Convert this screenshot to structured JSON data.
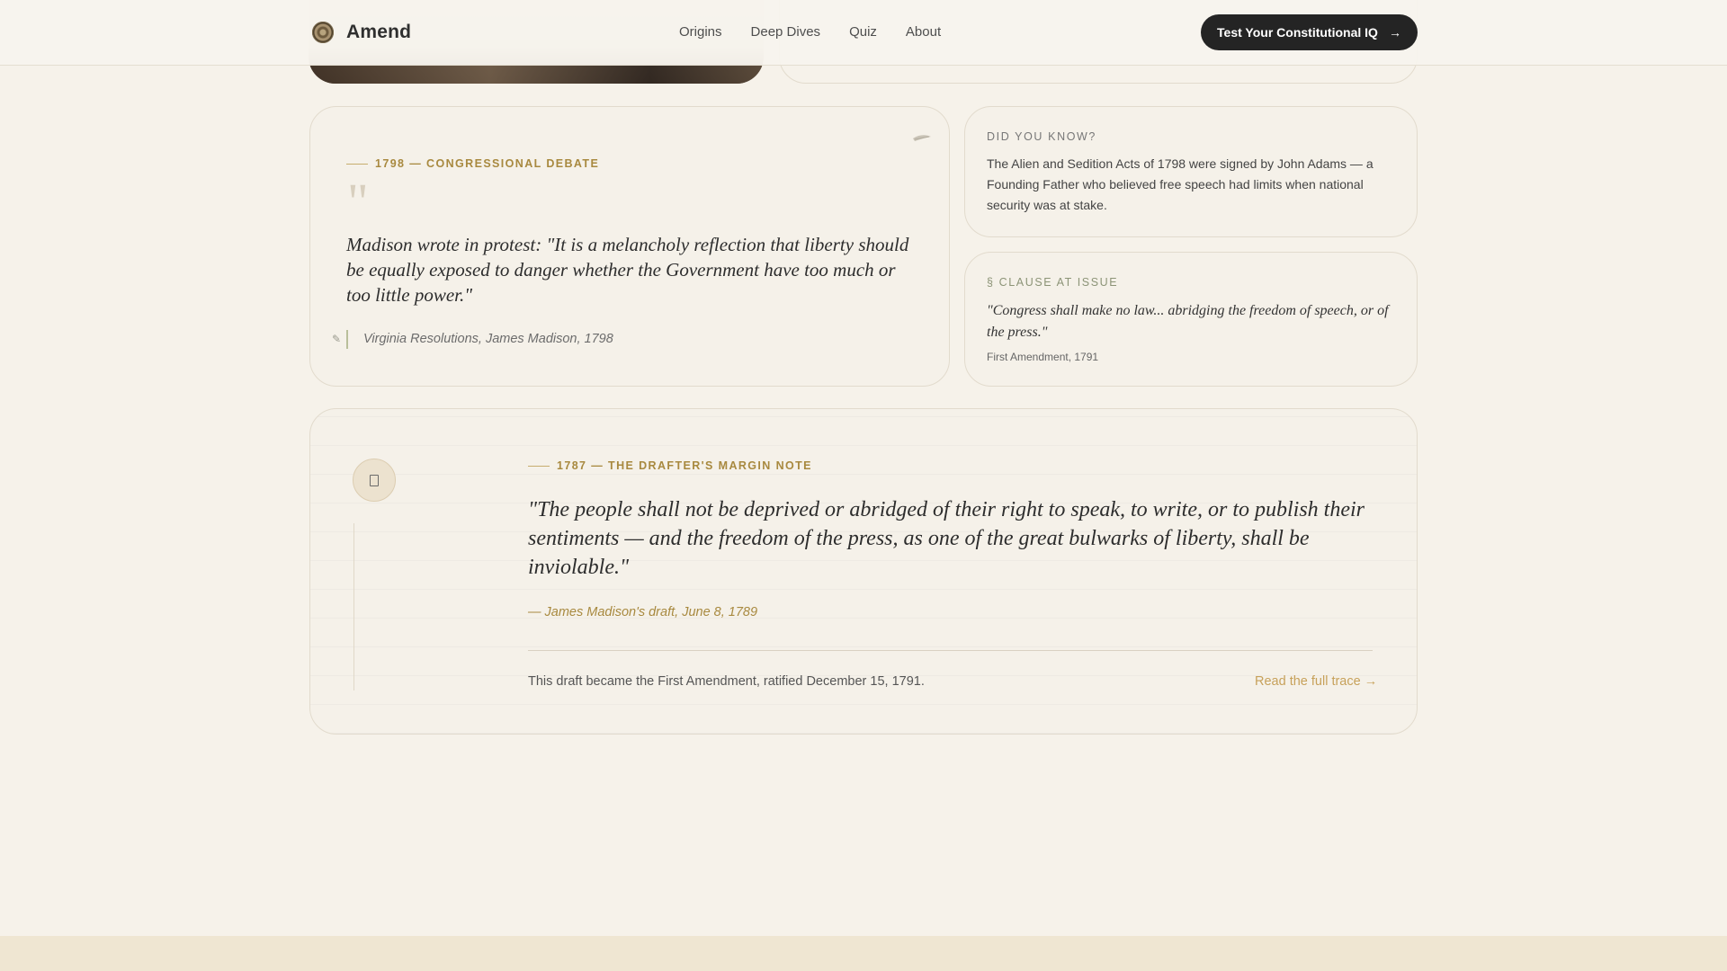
{
  "header": {
    "brand": "Amend",
    "nav": [
      "Origins",
      "Deep Dives",
      "Quiz",
      "About"
    ],
    "cta_label": "Test Your Constitutional IQ"
  },
  "debate": {
    "overline": "1798 — CONGRESSIONAL DEBATE",
    "quote_mark": "\"",
    "quote": "Madison wrote in protest: \"It is a melancholy reflection that liberty should be equally exposed to danger whether the Government have too much or too little power.\"",
    "citation": "Virginia Resolutions, James Madison, 1798"
  },
  "did_you_know": {
    "label": "DID YOU KNOW?",
    "text": "The Alien and Sedition Acts of 1798 were signed by John Adams — a Founding Father who believed free speech had limits when national security was at stake."
  },
  "clause": {
    "label": "§ CLAUSE AT ISSUE",
    "quote": "\"Congress shall make no law... abridging the freedom of speech, or of the press.\"",
    "source": "First Amendment, 1791"
  },
  "margin_note": {
    "overline": "1787 — THE DRAFTER'S MARGIN NOTE",
    "quote": "\"The people shall not be deprived or abridged of their right to speak, to write, or to publish their sentiments — and the freedom of the press, as one of the great bulwarks of liberty, shall be inviolable.\"",
    "author": "— James Madison's draft, June 8, 1789",
    "footer": "This draft became the First Amendment, ratified December 15, 1791.",
    "link": "Read the full trace →"
  },
  "colors": {
    "background": "#f6f2ea",
    "accent_gold": "#a8893f",
    "cta_bg": "#242424"
  }
}
